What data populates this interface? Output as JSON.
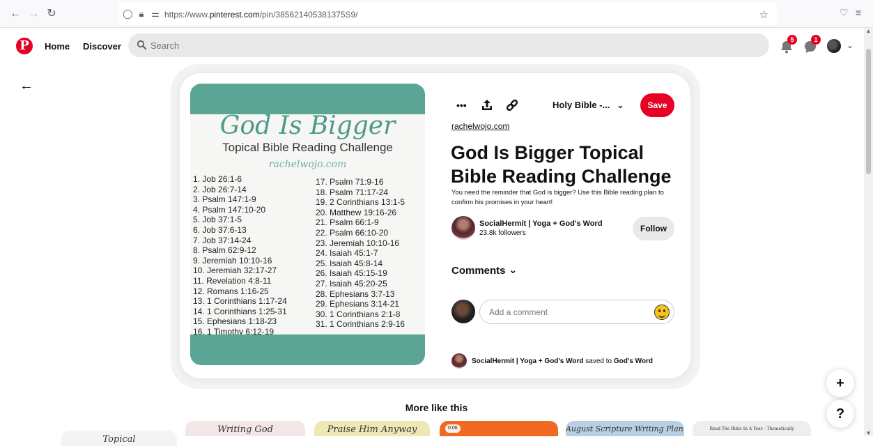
{
  "browser": {
    "url_prefix": "https://www.",
    "url_domain": "pinterest.com",
    "url_path": "/pin/385621405381375S9/"
  },
  "header": {
    "home_label": "Home",
    "discover_label": "Discover",
    "search_placeholder": "Search",
    "notifications_count": "5",
    "messages_count": "1"
  },
  "pin": {
    "image": {
      "title": "God Is Bigger",
      "subtitle": "Topical Bible Reading Challenge",
      "site": "rachelwojo.com",
      "readings_col1": [
        "1. Job 26:1-6",
        "2. Job 26:7-14",
        "3. Psalm 147:1-9",
        "4. Psalm 147:10-20",
        "5. Job 37:1-5",
        "6. Job 37:6-13",
        "7. Job 37:14-24",
        "8. Psalm 62:9-12",
        "9. Jeremiah 10:10-16",
        "10. Jeremiah 32:17-27",
        "11. Revelation 4:8-11",
        "12. Romans 1:16-25",
        "13. 1 Corinthians 1:17-24",
        "14. 1 Corinthians 1:25-31",
        "15. Ephesians 1:18-23",
        "16. 1 Timothy 6:12-19"
      ],
      "readings_col2": [
        "17. Psalm 71:9-16",
        "18. Psalm 71:17-24",
        "19. 2 Corinthians 13:1-5",
        "20. Matthew 19:16-26",
        "21. Psalm 66:1-9",
        "22. Psalm 66:10-20",
        "23. Jeremiah 10:10-16",
        "24. Isaiah 45:1-7",
        "25. Isaiah 45:8-14",
        "26. Isaiah 45:15-19",
        "27. Isaiah 45:20-25",
        "28. Ephesians 3:7-13",
        "29. Ephesians 3:14-21",
        "30. 1 Corinthians 2:1-8",
        "31. 1 Corinthians 2:9-16"
      ]
    },
    "more_label": "•••",
    "board_label": "Holy Bible -...",
    "save_label": "Save",
    "source": "rachelwojo.com",
    "title": "God Is Bigger Topical Bible Reading Challenge",
    "description": "You need the reminder that God is bigger? Use this Bible reading plan to confirm his promises in your heart!",
    "creator": {
      "name": "SocialHermit | Yoga + God's Word",
      "followers": "23.8k followers",
      "follow_label": "Follow"
    },
    "comments_label": "Comments",
    "comment_placeholder": "Add a comment",
    "saved": {
      "user": "SocialHermit | Yoga + God's Word",
      "verb": " saved to ",
      "board": "God's Word"
    }
  },
  "fab": {
    "add_label": "+",
    "help_label": "?"
  },
  "more_like_this": "More like this",
  "thumbnails": [
    {
      "text": "Topical",
      "bg": "#f4f4f4"
    },
    {
      "text": "Writing God",
      "bg": "#f3e6e6"
    },
    {
      "text": "Praise Him Anyway",
      "bg": "#efe8b4"
    },
    {
      "text": "",
      "bg": "#f26a21",
      "badge": "0:06"
    },
    {
      "text": "August Scripture Writing Plan:",
      "bg": "#b9cfe3"
    },
    {
      "text": "Read The Bible In A Year - Thematically",
      "bg": "#eeeeee"
    }
  ],
  "colors": {
    "brand_red": "#e60023",
    "lace_teal": "#5aa594"
  }
}
